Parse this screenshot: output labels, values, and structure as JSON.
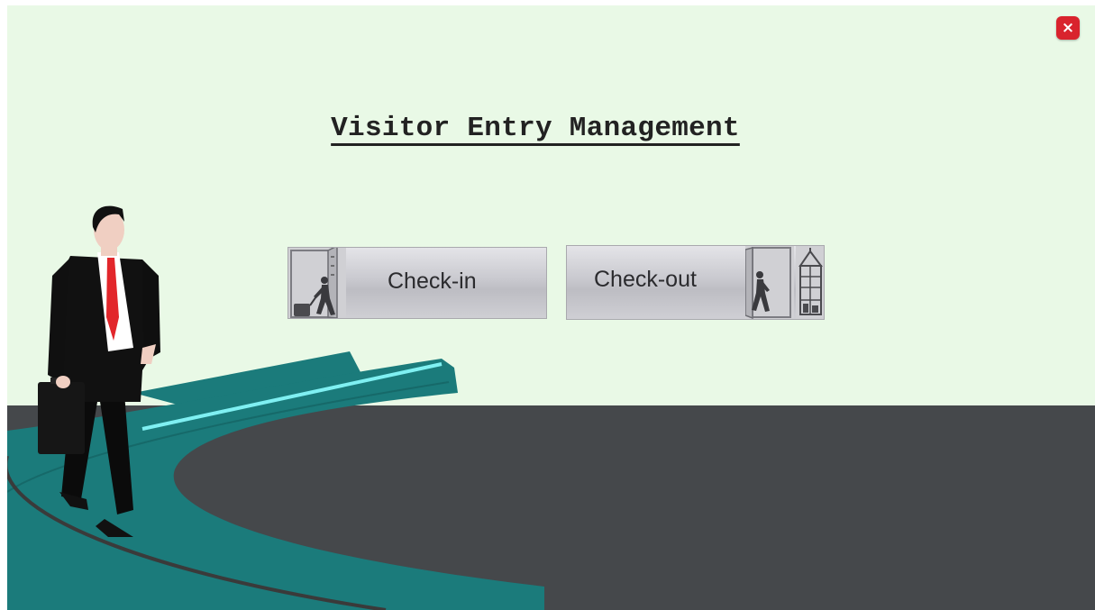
{
  "app": {
    "title": "Visitor Entry Management",
    "close_label": "×"
  },
  "actions": {
    "checkin_label": "Check-in",
    "checkout_label": "Check-out"
  },
  "icons": {
    "close": "close-icon",
    "checkin": "door-walking-person-icon",
    "checkout": "door-walking-person-icon",
    "cabinet": "cabinet-icon",
    "businessman": "businessman-illustration"
  },
  "colors": {
    "background": "#e9f9e6",
    "floor": "#45484b",
    "walkway": "#1b7b7b",
    "walkway_highlight": "#7ff0f2",
    "close_button": "#d9232d",
    "tie": "#e2262b"
  }
}
